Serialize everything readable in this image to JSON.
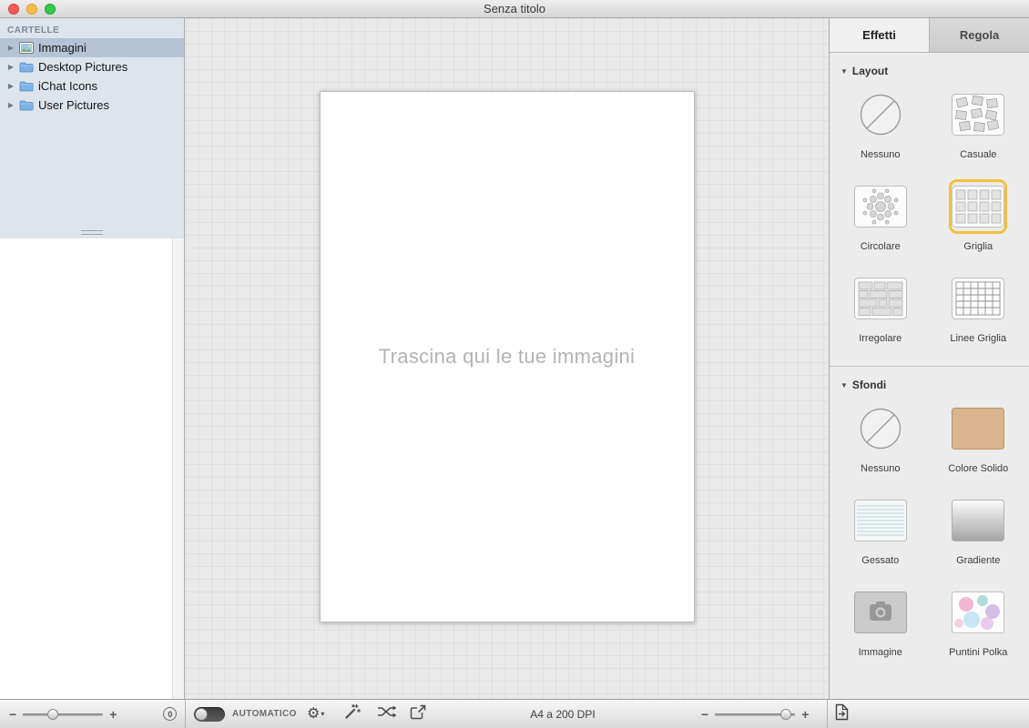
{
  "window": {
    "title": "Senza titolo"
  },
  "sidebar": {
    "header": "CARTELLE",
    "items": [
      {
        "label": "Immagini",
        "icon": "photo-album-icon",
        "selected": true
      },
      {
        "label": "Desktop Pictures",
        "icon": "folder-icon",
        "selected": false
      },
      {
        "label": "iChat Icons",
        "icon": "folder-icon",
        "selected": false
      },
      {
        "label": "User Pictures",
        "icon": "folder-icon",
        "selected": false
      }
    ]
  },
  "canvas": {
    "placeholder": "Trascina qui le tue immagini"
  },
  "panel": {
    "tabs": [
      {
        "label": "Effetti",
        "active": true
      },
      {
        "label": "Regola",
        "active": false
      }
    ],
    "sections": [
      {
        "title": "Layout",
        "items": [
          {
            "label": "Nessuno",
            "icon": "none-icon",
            "selected": false
          },
          {
            "label": "Casuale",
            "icon": "random-layout-icon",
            "selected": false
          },
          {
            "label": "Circolare",
            "icon": "circular-layout-icon",
            "selected": false
          },
          {
            "label": "Griglia",
            "icon": "grid-layout-icon",
            "selected": true
          },
          {
            "label": "Irregolare",
            "icon": "irregular-layout-icon",
            "selected": false
          },
          {
            "label": "Linee Griglia",
            "icon": "grid-lines-icon",
            "selected": false
          }
        ]
      },
      {
        "title": "Sfondi",
        "items": [
          {
            "label": "Nessuno",
            "icon": "none-icon",
            "selected": false
          },
          {
            "label": "Colore Solido",
            "icon": "solid-color-icon",
            "selected": false
          },
          {
            "label": "Gessato",
            "icon": "striped-icon",
            "selected": false
          },
          {
            "label": "Gradiente",
            "icon": "gradient-icon",
            "selected": false
          },
          {
            "label": "Immagine",
            "icon": "image-icon",
            "selected": false
          },
          {
            "label": "Puntini Polka",
            "icon": "polka-dots-icon",
            "selected": false
          }
        ]
      }
    ]
  },
  "toolbar": {
    "minus_label": "−",
    "plus_label": "+",
    "reset_label": "0",
    "automatic_label": "AUTOMATICO",
    "status": "A4 a 200 DPI"
  },
  "icons": {
    "gear": "⚙",
    "dropdown_arrow": "▾",
    "disclosure_collapsed": "▶",
    "disclosure_expanded": "▼"
  },
  "colors": {
    "selection_accent": "#f1c13e",
    "sidebar_selection": "#b5c3d5",
    "solid_color_swatch": "#d9b48f"
  }
}
